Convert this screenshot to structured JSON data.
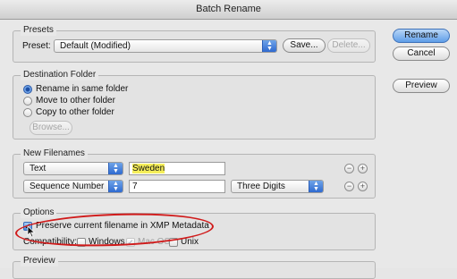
{
  "window": {
    "title": "Batch Rename"
  },
  "presets": {
    "legend": "Presets",
    "preset_label": "Preset:",
    "preset_value": "Default (Modified)",
    "save_label": "Save...",
    "delete_label": "Delete..."
  },
  "side_buttons": {
    "rename": "Rename",
    "cancel": "Cancel",
    "preview": "Preview"
  },
  "destination": {
    "legend": "Destination Folder",
    "options": [
      "Rename in same folder",
      "Move to other folder",
      "Copy to other folder"
    ],
    "selected": 0,
    "browse_label": "Browse..."
  },
  "new_filenames": {
    "legend": "New Filenames",
    "rows": [
      {
        "type": "Text",
        "value": "Sweden"
      },
      {
        "type": "Sequence Number",
        "value": "7",
        "digits": "Three Digits"
      }
    ]
  },
  "options": {
    "legend": "Options",
    "preserve_label": "Preserve current filename in XMP Metadata",
    "preserve_checked": true,
    "compat_label": "Compatibility:",
    "compat": [
      {
        "label": "Windows",
        "checked": false
      },
      {
        "label": "Mac OS",
        "checked": true,
        "disabled": true
      },
      {
        "label": "Unix",
        "checked": false
      }
    ]
  },
  "preview": {
    "legend": "Preview"
  },
  "colors": {
    "annotation": "#d01a1a",
    "highlight": "#f5ee5a",
    "accent": "#3a78d2"
  }
}
